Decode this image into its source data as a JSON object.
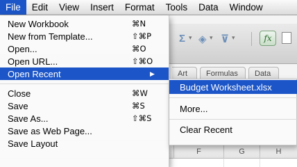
{
  "menubar": {
    "items": [
      {
        "label": "File",
        "active": true
      },
      {
        "label": "Edit"
      },
      {
        "label": "View"
      },
      {
        "label": "Insert"
      },
      {
        "label": "Format"
      },
      {
        "label": "Tools"
      },
      {
        "label": "Data"
      },
      {
        "label": "Window"
      }
    ]
  },
  "file_menu": {
    "items": [
      {
        "label": "New Workbook",
        "shortcut": "⌘N"
      },
      {
        "label": "New from Template...",
        "shortcut": "⇧⌘P"
      },
      {
        "label": "Open...",
        "shortcut": "⌘O"
      },
      {
        "label": "Open URL...",
        "shortcut": "⇧⌘O"
      },
      {
        "label": "Open Recent",
        "submenu_arrow": "▶",
        "selected": true
      },
      {
        "label": "Close",
        "shortcut": "⌘W"
      },
      {
        "label": "Save",
        "shortcut": "⌘S"
      },
      {
        "label": "Save As...",
        "shortcut": "⇧⌘S"
      },
      {
        "label": "Save as Web Page..."
      },
      {
        "label": "Save Layout"
      }
    ]
  },
  "open_recent_submenu": {
    "items": [
      {
        "label": "Budget Worksheet.xlsx",
        "selected": true
      },
      {
        "label": "More..."
      },
      {
        "label": "Clear Recent"
      }
    ]
  },
  "background": {
    "ribbon_tabs": [
      "Art",
      "Formulas",
      "Data"
    ],
    "column_headers": [
      "F",
      "G",
      "H"
    ],
    "toolbar_icons": [
      "autosum-icon",
      "fill-icon",
      "filter-icon",
      "function-icon",
      "toolbox-icon"
    ],
    "fx_label": "fx"
  },
  "colors": {
    "selection": "#1c55c7",
    "menu_background": "#fafafa"
  }
}
